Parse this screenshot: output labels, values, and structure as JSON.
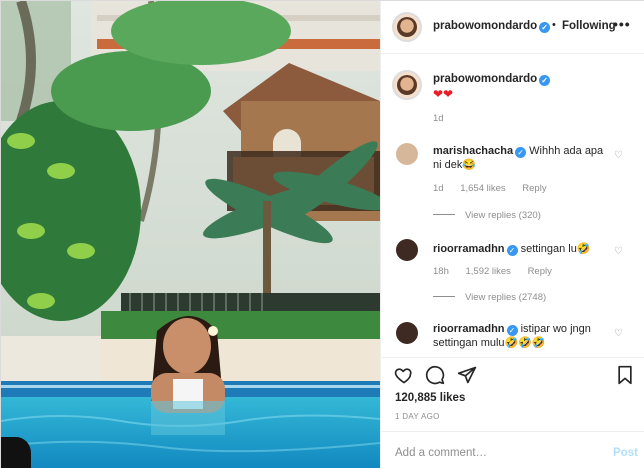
{
  "post": {
    "author": "prabowomondardo",
    "follow_status": "Following",
    "more_glyph": "•••",
    "caption_user": "prabowomondardo",
    "caption_text": "❤❤",
    "caption_age": "1d"
  },
  "comments": [
    {
      "user": "marishachacha",
      "text": "Wihhh ada apa ni dek😂",
      "age": "1d",
      "likes": "1,654 likes",
      "reply_label": "Reply",
      "view_replies": "View replies (320)"
    },
    {
      "user": "rioorramadhn",
      "text": "settingan lu🤣",
      "age": "18h",
      "likes": "1,592 likes",
      "reply_label": "Reply",
      "view_replies": "View replies (2748)"
    },
    {
      "user": "rioorramadhn",
      "text": "istipar wo jngn settingan mulu🤣🤣🤣"
    }
  ],
  "footer": {
    "like_count": "120,885 likes",
    "posted_ago": "1 DAY AGO",
    "add_comment_placeholder": "Add a comment…",
    "post_label": "Post"
  },
  "icons": {
    "like": "heart-outline-icon",
    "comment": "comment-bubble-icon",
    "share": "paper-plane-icon",
    "save": "bookmark-icon",
    "verified": "verified-badge-icon"
  }
}
